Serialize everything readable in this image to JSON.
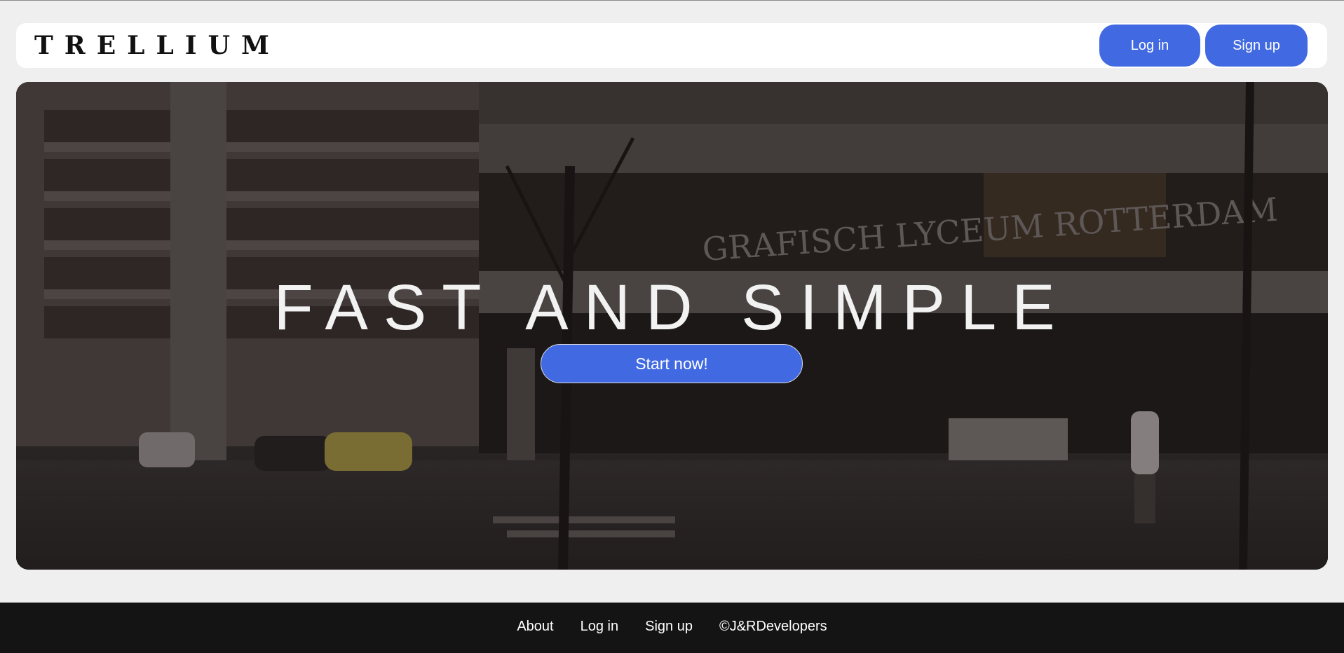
{
  "header": {
    "logo": "TRELLIUM",
    "login_label": "Log in",
    "signup_label": "Sign up"
  },
  "hero": {
    "title": "FAST AND SIMPLE",
    "cta_label": "Start now!",
    "sign_text": "GRAFISCH LYCEUM ROTTERDAM"
  },
  "footer": {
    "links": [
      "About",
      "Log in",
      "Sign up"
    ],
    "copyright": "©J&RDevelopers"
  },
  "colors": {
    "accent": "#4169e1",
    "page_background": "#efefef",
    "footer_background": "#141414"
  }
}
